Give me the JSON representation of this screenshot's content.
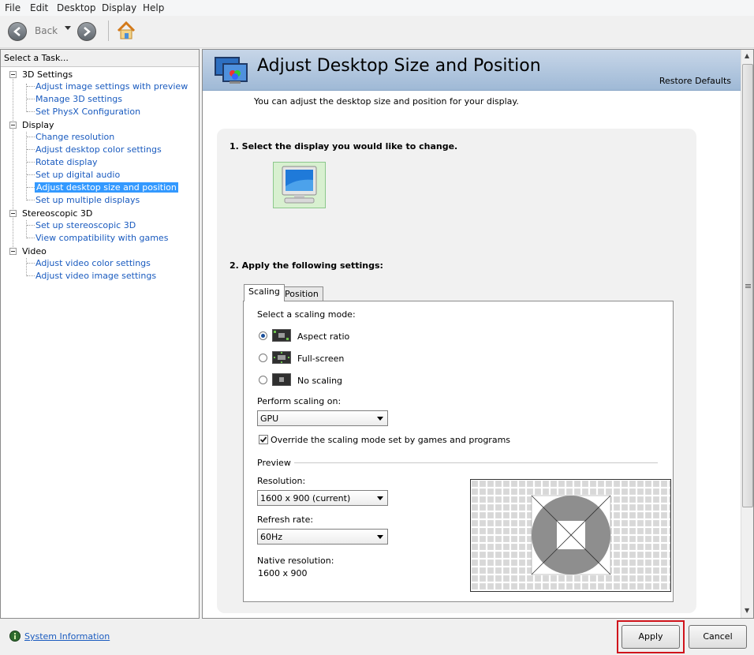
{
  "menu": [
    "File",
    "Edit",
    "Desktop",
    "Display",
    "Help"
  ],
  "toolbar": {
    "back_label": "Back"
  },
  "left_panel": {
    "header": "Select a Task...",
    "categories": [
      {
        "label": "3D Settings",
        "items": [
          "Adjust image settings with preview",
          "Manage 3D settings",
          "Set PhysX Configuration"
        ]
      },
      {
        "label": "Display",
        "items": [
          "Change resolution",
          "Adjust desktop color settings",
          "Rotate display",
          "Set up digital audio",
          "Adjust desktop size and position",
          "Set up multiple displays"
        ]
      },
      {
        "label": "Stereoscopic 3D",
        "items": [
          "Set up stereoscopic 3D",
          "View compatibility with games"
        ]
      },
      {
        "label": "Video",
        "items": [
          "Adjust video color settings",
          "Adjust video image settings"
        ]
      }
    ],
    "selected": "Adjust desktop size and position"
  },
  "page": {
    "title": "Adjust Desktop Size and Position",
    "restore_defaults": "Restore Defaults",
    "description": "You can adjust the desktop size and position for your display.",
    "step1": "1. Select the display you would like to change.",
    "step2": "2. Apply the following settings:"
  },
  "tabs": {
    "scaling": "Scaling",
    "position": "Position"
  },
  "scaling": {
    "mode_label": "Select a scaling mode:",
    "modes": [
      "Aspect ratio",
      "Full-screen",
      "No scaling"
    ],
    "selected_mode": "Aspect ratio",
    "perform_label": "Perform scaling on:",
    "perform_value": "GPU",
    "override_label": "Override the scaling mode set by games and programs",
    "override_checked": true
  },
  "preview": {
    "section_label": "Preview",
    "resolution_label": "Resolution:",
    "resolution_value": "1600 x 900 (current)",
    "refresh_label": "Refresh rate:",
    "refresh_value": "60Hz",
    "native_label": "Native resolution:",
    "native_value": "1600 x 900"
  },
  "footer": {
    "system_info": "System Information",
    "apply": "Apply",
    "cancel": "Cancel"
  },
  "colors": {
    "link": "#1a5bbf",
    "selection": "#3399ff",
    "highlight_border": "#d0141c"
  }
}
